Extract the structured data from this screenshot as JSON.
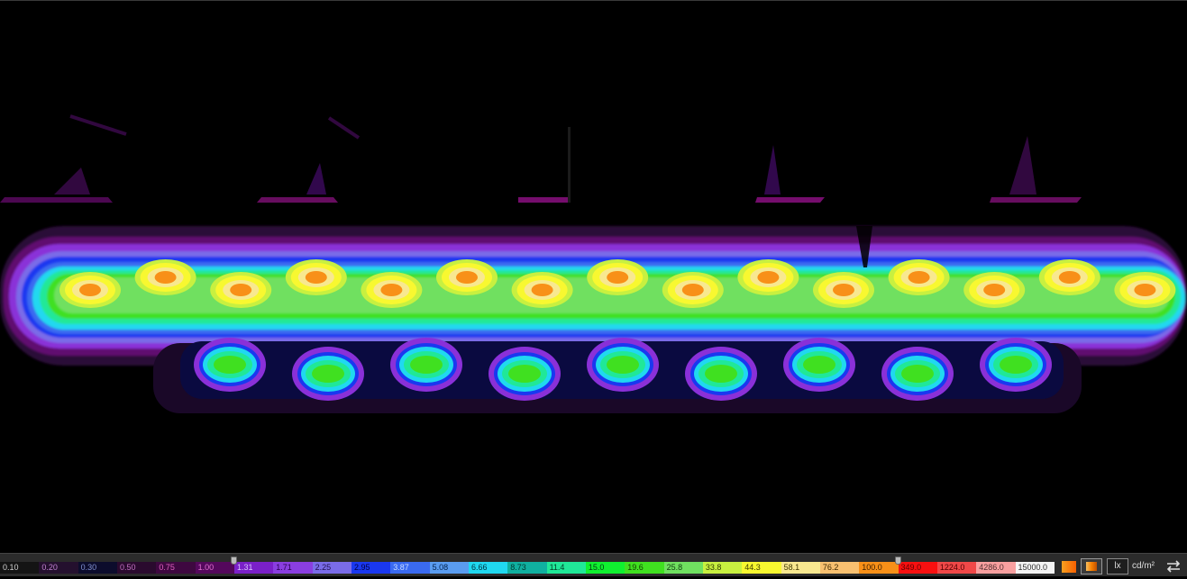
{
  "legend": {
    "units": [
      "lx",
      "cd/m²"
    ],
    "active_unit": "lx",
    "steps": [
      {
        "label": "0.10",
        "bg": "#141414",
        "fg": "#d0d0d0"
      },
      {
        "label": "0.20",
        "bg": "#24102e",
        "fg": "#c080d0"
      },
      {
        "label": "0.30",
        "bg": "#0c0c2c",
        "fg": "#8090d0"
      },
      {
        "label": "0.50",
        "bg": "#2a0a2e",
        "fg": "#c070c0"
      },
      {
        "label": "0.75",
        "bg": "#3e0840",
        "fg": "#e060c0"
      },
      {
        "label": "1.00",
        "bg": "#54085c",
        "fg": "#e070d0"
      },
      {
        "label": "1.31",
        "bg": "#7a20c8",
        "fg": "#d8c0ff"
      },
      {
        "label": "1.71",
        "bg": "#8a3ee0",
        "fg": "#2a0050"
      },
      {
        "label": "2.25",
        "bg": "#7a6ce8",
        "fg": "#201050"
      },
      {
        "label": "2.95",
        "bg": "#1a38f0",
        "fg": "#000044"
      },
      {
        "label": "3.87",
        "bg": "#3a6af0",
        "fg": "#c8dcff"
      },
      {
        "label": "5.08",
        "bg": "#5a9cf0",
        "fg": "#00204a"
      },
      {
        "label": "6.66",
        "bg": "#20d8f0",
        "fg": "#003040"
      },
      {
        "label": "8.73",
        "bg": "#10b0a0",
        "fg": "#003830"
      },
      {
        "label": "11.4",
        "bg": "#20e898",
        "fg": "#004028"
      },
      {
        "label": "15.0",
        "bg": "#10f030",
        "fg": "#004010"
      },
      {
        "label": "19.6",
        "bg": "#40e020",
        "fg": "#104000"
      },
      {
        "label": "25.8",
        "bg": "#70e060",
        "fg": "#104010"
      },
      {
        "label": "33.8",
        "bg": "#c8f040",
        "fg": "#304000"
      },
      {
        "label": "44.3",
        "bg": "#f8f830",
        "fg": "#404000"
      },
      {
        "label": "58.1",
        "bg": "#f8e890",
        "fg": "#403800"
      },
      {
        "label": "76.2",
        "bg": "#f8c070",
        "fg": "#402800"
      },
      {
        "label": "100.0",
        "bg": "#f89018",
        "fg": "#402000"
      },
      {
        "label": "349.0",
        "bg": "#f81010",
        "fg": "#600000"
      },
      {
        "label": "1224.0",
        "bg": "#f04848",
        "fg": "#500000"
      },
      {
        "label": "4286.0",
        "bg": "#f8a0a0",
        "fg": "#503030"
      },
      {
        "label": "15000.0",
        "bg": "#f4f4f4",
        "fg": "#303030"
      }
    ],
    "markers": [
      {
        "name": "lower-range-marker",
        "step_index": 5
      },
      {
        "name": "upper-range-marker",
        "step_index": 22
      }
    ]
  },
  "colors": {
    "background": "#000000",
    "toolbar": "#2b2b2b"
  },
  "tools": {
    "gradient_icon": "gradient-icon",
    "swap_icon": "swap-arrows-icon"
  }
}
